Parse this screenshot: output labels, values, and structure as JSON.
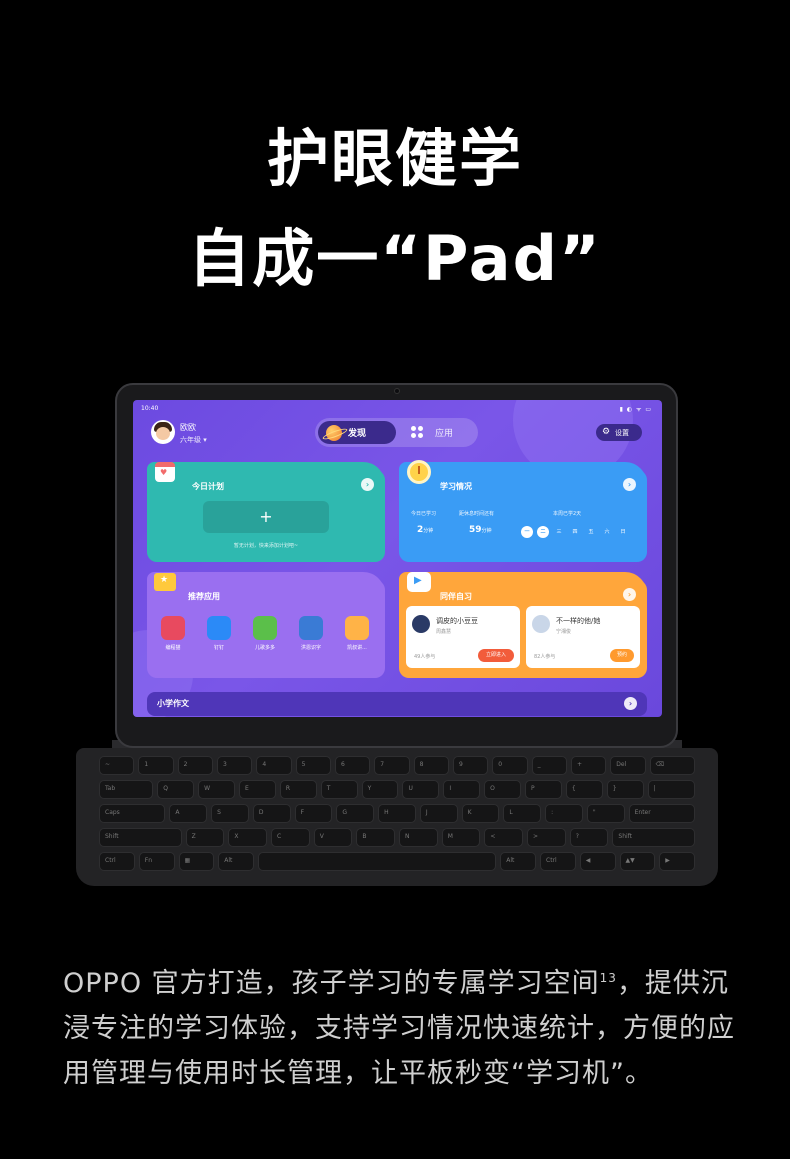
{
  "headline": {
    "line1": "护眼健学",
    "line2": "自成一“Pad”"
  },
  "tablet": {
    "status": {
      "time": "10:40",
      "icons": "▮ ◐ ᯤ ▭"
    },
    "profile": {
      "name": "欧欧",
      "grade": "六年级 ▾"
    },
    "tabs": [
      {
        "label": "发现",
        "active": true
      },
      {
        "label": "应用",
        "active": false
      }
    ],
    "settings_label": "设置",
    "cards": {
      "plan": {
        "title": "今日计划",
        "add": "+",
        "empty_text": "暂无计划，快来添加计划吧~"
      },
      "study": {
        "title": "学习情况",
        "today_label": "今日已学习",
        "today_value": "2",
        "today_unit": "分钟",
        "rest_label": "距休息时间还有",
        "rest_value": "59",
        "rest_unit": "分钟",
        "week_label": "本周已学2天",
        "days": [
          {
            "d": "一",
            "on": true
          },
          {
            "d": "二",
            "on": true
          },
          {
            "d": "三",
            "on": false
          },
          {
            "d": "四",
            "on": false
          },
          {
            "d": "五",
            "on": false
          },
          {
            "d": "六",
            "on": false
          },
          {
            "d": "日",
            "on": false
          }
        ]
      },
      "recommend": {
        "title": "推荐应用",
        "apps": [
          {
            "label": "编程猫",
            "icon": "cat-icon",
            "color": "#e84a5f"
          },
          {
            "label": "钉钉",
            "icon": "dingtalk-icon",
            "color": "#2b8af7"
          },
          {
            "label": "儿歌多多",
            "icon": "music-icon",
            "color": "#5bbf4a"
          },
          {
            "label": "洪恩识字",
            "icon": "reading-icon",
            "color": "#3a7bd5"
          },
          {
            "label": "凯叔讲...",
            "icon": "storyteller-icon",
            "color": "#ffb347"
          }
        ]
      },
      "peer": {
        "title": "同伴自习",
        "rooms": [
          {
            "name": "调皮的小豆豆",
            "teacher": "周鑫慧",
            "count": "49人参与",
            "button": "立即进入",
            "btn_color": "#f25c3b",
            "avatar_color": "#2a3a66"
          },
          {
            "name": "不一样的他/她",
            "teacher": "宁湘俊",
            "count": "82人参与",
            "button": "预约",
            "btn_color": "#ff9a2e",
            "avatar_color": "#c9d6e8"
          }
        ]
      },
      "essay": {
        "title": "小学作文"
      }
    }
  },
  "keyboard": {
    "rows": [
      [
        "~",
        "1",
        "2",
        "3",
        "4",
        "5",
        "6",
        "7",
        "8",
        "9",
        "0",
        "_",
        "+",
        "Del",
        "⌫"
      ],
      [
        "Tab",
        "Q",
        "W",
        "E",
        "R",
        "T",
        "Y",
        "U",
        "I",
        "O",
        "P",
        "{",
        "}",
        "|"
      ],
      [
        "Caps",
        "A",
        "S",
        "D",
        "F",
        "G",
        "H",
        "J",
        "K",
        "L",
        ":",
        "\"",
        "Enter"
      ],
      [
        "Shift",
        "Z",
        "X",
        "C",
        "V",
        "B",
        "N",
        "M",
        "<",
        ">",
        "?",
        "Shift"
      ],
      [
        "Ctrl",
        "Fn",
        "▦",
        "Alt",
        " ",
        "Alt",
        "Ctrl",
        "◀",
        "▲▼",
        "▶"
      ]
    ]
  },
  "body_text": {
    "part1": "OPPO 官方打造，孩子学习的专属学习空间",
    "sup": "13",
    "part2": "，提供沉浸专注的学习体验，支持学习情况快速统计，方便的应用管理与使用时长管理，让平板秒变“学习机”。"
  }
}
